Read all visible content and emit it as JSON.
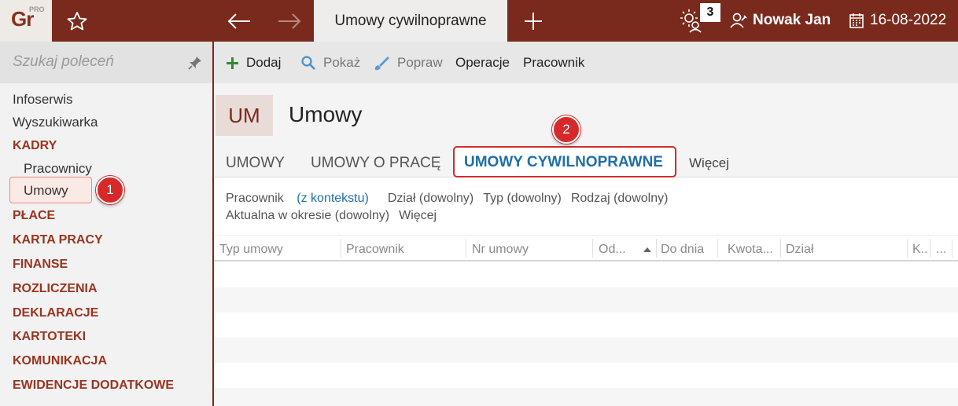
{
  "app": {
    "logo": "Gr",
    "logo_badge": "PRO",
    "active_tab": "Umowy cywilnoprawne",
    "notification_count": "3",
    "user_name": "Nowak Jan",
    "date": "16-08-2022",
    "accent_color": "#7a2a1c"
  },
  "sidebar": {
    "search_placeholder": "Szukaj poleceń",
    "items": [
      {
        "label": "Infoserwis"
      },
      {
        "label": "Wyszukiwarka"
      }
    ],
    "kadry": {
      "label": "KADRY",
      "sub": [
        {
          "label": "Pracownicy"
        },
        {
          "label": "Umowy"
        }
      ]
    },
    "categories": [
      {
        "label": "PŁACE"
      },
      {
        "label": "KARTA PRACY"
      },
      {
        "label": "FINANSE"
      },
      {
        "label": "ROZLICZENIA"
      },
      {
        "label": "DEKLARACJE"
      },
      {
        "label": "KARTOTEKI"
      },
      {
        "label": "KOMUNIKACJA"
      },
      {
        "label": "EWIDENCJE DODATKOWE"
      }
    ]
  },
  "markers": {
    "m1": "1",
    "m2": "2"
  },
  "toolbar": {
    "add": "Dodaj",
    "show": "Pokaż",
    "edit": "Popraw",
    "operations": "Operacje",
    "employee": "Pracownik"
  },
  "page": {
    "badge": "UM",
    "title": "Umowy"
  },
  "tabs": [
    {
      "label": "UMOWY"
    },
    {
      "label": "UMOWY O PRACĘ"
    },
    {
      "label": "UMOWY CYWILNOPRAWNE"
    }
  ],
  "tabs_more": "Więcej",
  "filters": {
    "employee_label": "Pracownik",
    "employee_value": "(z kontekstu)",
    "department": "Dział (dowolny)",
    "type": "Typ (dowolny)",
    "kind": "Rodzaj (dowolny)",
    "period": "Aktualna w okresie (dowolny)",
    "more": "Więcej"
  },
  "grid": {
    "columns": [
      {
        "label": "Typ umowy"
      },
      {
        "label": "Pracownik"
      },
      {
        "label": "Nr umowy"
      },
      {
        "label": "Od..."
      },
      {
        "label": "Do dnia"
      },
      {
        "label": "Kwota..."
      },
      {
        "label": "Dział"
      },
      {
        "label": "K.."
      },
      {
        "label": "..."
      }
    ]
  }
}
